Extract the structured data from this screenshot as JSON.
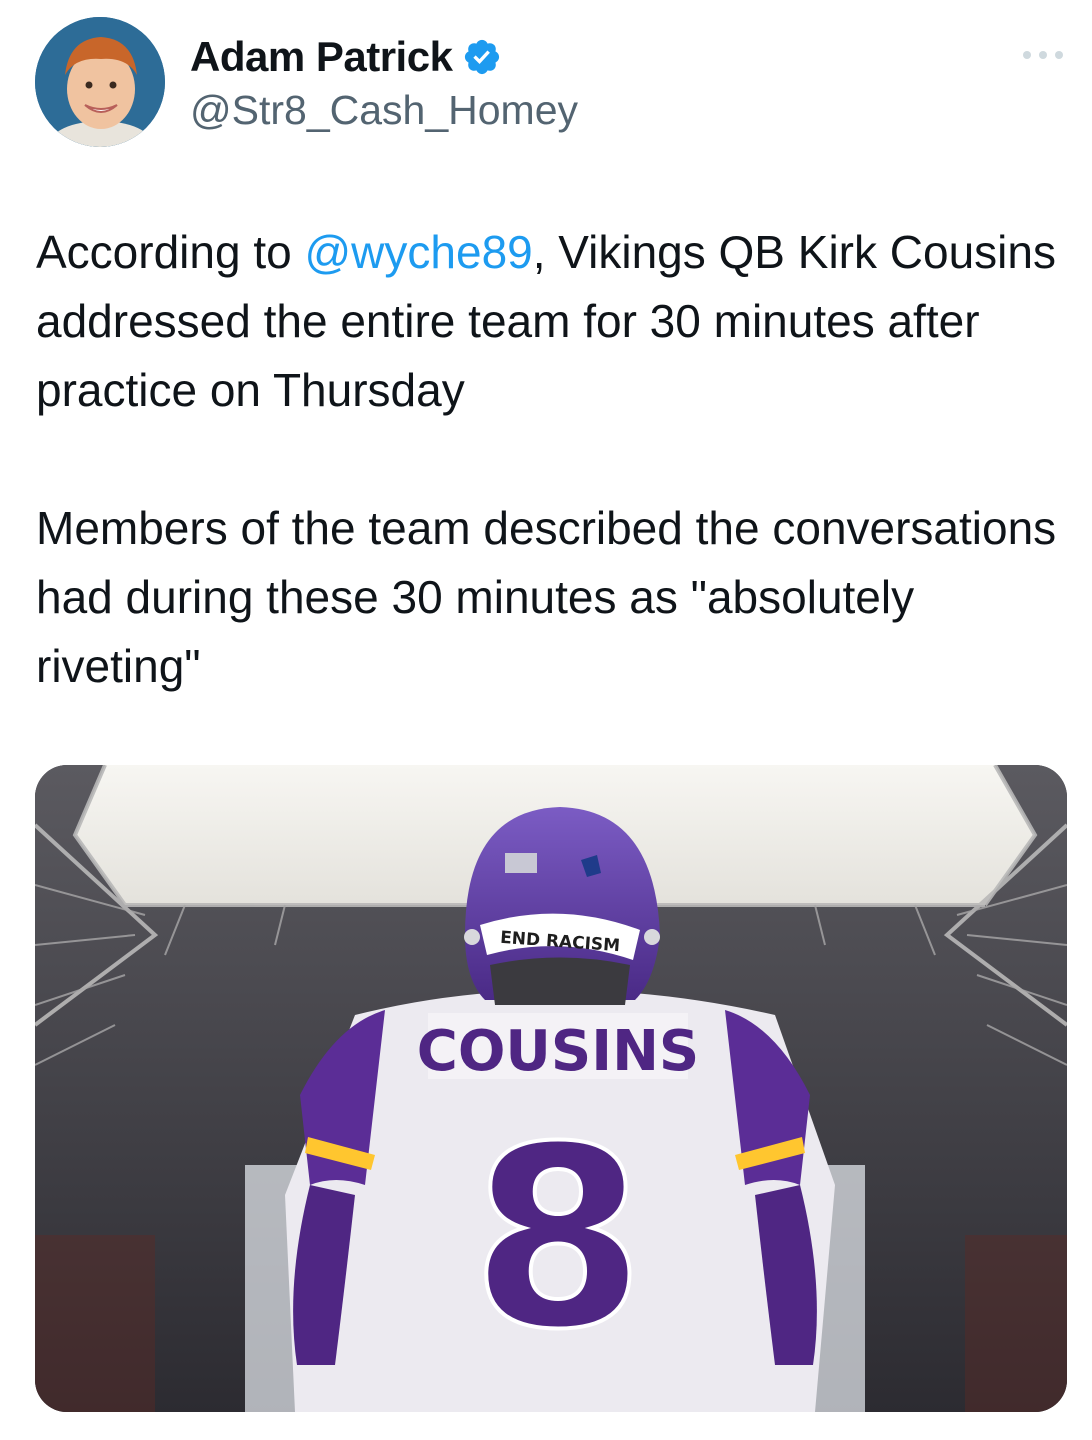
{
  "tweet": {
    "author": {
      "display_name": "Adam Patrick",
      "handle": "@Str8_Cash_Homey",
      "verified": true,
      "verified_icon": "verified-badge-icon",
      "avatar": "avatar-child-photo"
    },
    "more_icon": "more-options-icon",
    "text": {
      "p1_before": "According to ",
      "p1_mention": "@wyche89",
      "p1_after": ", Vikings QB Kirk Cousins addressed the entire team for 30 minutes after practice on Thursday",
      "p2": "Members of the team described the conversations had during these 30 minutes as \"absolutely riveting\""
    },
    "media": {
      "jersey_name": "COUSINS",
      "jersey_number": "8",
      "helmet_text": "END RACISM"
    },
    "colors": {
      "mention": "#1d9bf0",
      "verified": "#1d9bf0",
      "secondary_text": "#536471",
      "viking_purple": "#4f2683",
      "viking_gold": "#ffc62f"
    }
  }
}
